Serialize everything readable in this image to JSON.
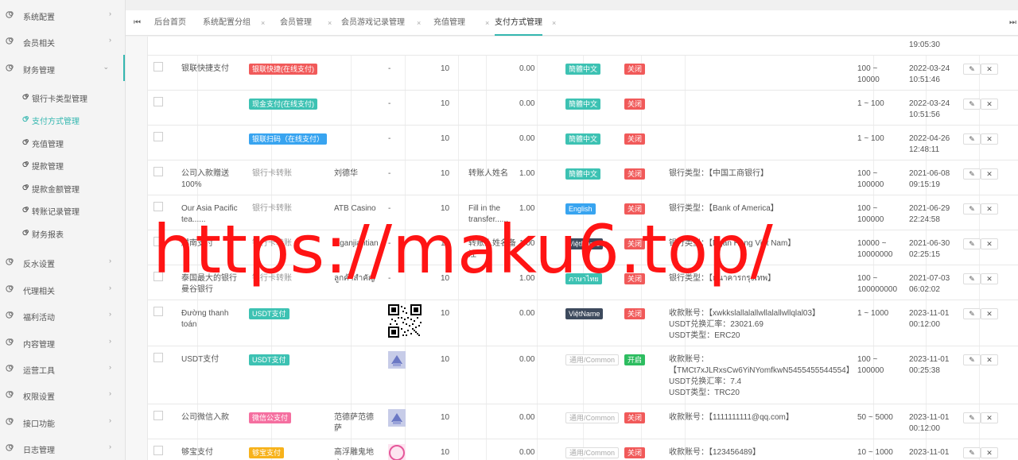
{
  "sidebar": {
    "items": [
      {
        "label": "系统配置",
        "arrow": "›"
      },
      {
        "label": "会员相关",
        "arrow": "›"
      },
      {
        "label": "财务管理",
        "arrow": "⌄"
      },
      {
        "label": "反水设置",
        "arrow": "›"
      },
      {
        "label": "代理相关",
        "arrow": "›"
      },
      {
        "label": "福利活动",
        "arrow": "›"
      },
      {
        "label": "内容管理",
        "arrow": "›"
      },
      {
        "label": "运营工具",
        "arrow": "›"
      },
      {
        "label": "权限设置",
        "arrow": "›"
      },
      {
        "label": "接口功能",
        "arrow": "›"
      },
      {
        "label": "日志管理",
        "arrow": "›"
      }
    ],
    "sub_items": [
      {
        "label": "银行卡类型管理"
      },
      {
        "label": "支付方式管理"
      },
      {
        "label": "充值管理"
      },
      {
        "label": "提款管理"
      },
      {
        "label": "提款金额管理"
      },
      {
        "label": "转账记录管理"
      },
      {
        "label": "财务报表"
      }
    ]
  },
  "tabs": {
    "first_icon": "⏮",
    "last_icon": "⏭",
    "items": [
      {
        "label": "后台首页",
        "close": ""
      },
      {
        "label": "系统配置分组",
        "close": "×"
      },
      {
        "label": "会员管理",
        "close": "×"
      },
      {
        "label": "会员游戏记录管理",
        "close": "×"
      },
      {
        "label": "充值管理",
        "close": "×"
      },
      {
        "label": "支付方式管理",
        "close": "×"
      }
    ]
  },
  "watermark": "https://maku6.top/",
  "top_partial": {
    "time": "19:05:30"
  },
  "rows": [
    {
      "name": "银联快捷支付",
      "type": "银联快捷(在线支付)",
      "type_color": "red",
      "account_name": "",
      "qr": "-",
      "sort": "10",
      "fee_label": "",
      "fee": "0.00",
      "lang": "簡體中文",
      "lang_color": "teal",
      "status": "关闭",
      "status_color": "red",
      "info": [
        "",
        ""
      ],
      "range": [
        "100 ~",
        "10000"
      ],
      "date": [
        "2022-03-24",
        "10:51:46"
      ]
    },
    {
      "name": "",
      "type": "现金支付(在线支付)",
      "type_color": "teal",
      "account_name": "",
      "qr": "-",
      "sort": "10",
      "fee_label": "",
      "fee": "0.00",
      "lang": "簡體中文",
      "lang_color": "teal",
      "status": "关闭",
      "status_color": "red",
      "info": [
        "",
        ""
      ],
      "range": [
        "1 ~ 100",
        ""
      ],
      "date": [
        "2022-03-24",
        "10:51:56"
      ]
    },
    {
      "name": "",
      "type": "银联扫码（在线支付）",
      "type_color": "blue",
      "account_name": "",
      "qr": "-",
      "sort": "10",
      "fee_label": "",
      "fee": "0.00",
      "lang": "簡體中文",
      "lang_color": "teal",
      "status": "关闭",
      "status_color": "red",
      "info": [
        "",
        ""
      ],
      "range": [
        "1 ~ 100",
        ""
      ],
      "date": [
        "2022-04-26",
        "12:48:11"
      ]
    },
    {
      "name": "公司入款赠送100%",
      "type": "银行卡转账",
      "type_color": "plain",
      "account_name": "刘德华",
      "qr": "-",
      "sort": "10",
      "fee_label": "转账人姓名",
      "fee": "1.00",
      "lang": "簡體中文",
      "lang_color": "teal",
      "status": "关闭",
      "status_color": "red",
      "info": [
        "银行类型：【中国工商银行】",
        ""
      ],
      "range": [
        "100 ~",
        "100000"
      ],
      "date": [
        "2021-06-08",
        "09:15:19"
      ]
    },
    {
      "name": "Our Asia Pacific tea......",
      "type": "银行卡转账",
      "type_color": "plain",
      "account_name": "ATB Casino",
      "qr": "-",
      "sort": "10",
      "fee_label": "Fill in the transfer......",
      "fee": "1.00",
      "lang": "English",
      "lang_color": "blue",
      "status": "关闭",
      "status_color": "red",
      "info": [
        "银行类型：【Bank of America】",
        ""
      ],
      "range": [
        "100 ~",
        "100000"
      ],
      "date": [
        "2021-06-29",
        "22:24:58"
      ]
    },
    {
      "name": "越南支付",
      "type": "银行卡转账",
      "type_color": "plain",
      "account_name": "Nganjiantian",
      "qr": "-",
      "sort": "10",
      "fee_label": "转账人姓名备注",
      "fee": "1.00",
      "lang": "ViệtName",
      "lang_color": "dark",
      "status": "关闭",
      "status_color": "red",
      "info": [
        "银行类型：【Ngân Hàng Việt Nam】",
        ""
      ],
      "range": [
        "10000 ~",
        "10000000"
      ],
      "date": [
        "2021-06-30",
        "02:25:15"
      ]
    },
    {
      "name": "泰国最大的银行曼谷银行",
      "type": "银行卡转账",
      "type_color": "plain",
      "account_name": "ลูกค้าสำคัญ",
      "qr": "-",
      "sort": "10",
      "fee_label": "",
      "fee": "1.00",
      "lang": "ภาษาไทย",
      "lang_color": "teal",
      "status": "关闭",
      "status_color": "red",
      "info": [
        "银行类型：【ธนาคารกรุงเทพ】",
        ""
      ],
      "range": [
        "100 ~",
        "100000000"
      ],
      "date": [
        "2021-07-03",
        "06:02:02"
      ]
    },
    {
      "name": "Đường thanh toán",
      "type": "USDT支付",
      "type_color": "teal",
      "account_name": "",
      "qr": "qr",
      "sort": "10",
      "fee_label": "",
      "fee": "0.00",
      "lang": "ViệtName",
      "lang_color": "dark",
      "status": "关闭",
      "status_color": "red",
      "info": [
        "收款账号：【xwkkslallalallwllalallwllqlal03】",
        "USDT兑换汇率：23021.69",
        "USDT类型：ERC20"
      ],
      "range": [
        "1 ~ 1000",
        ""
      ],
      "date": [
        "2023-11-01",
        "00:12:00"
      ]
    },
    {
      "name": "USDT支付",
      "type": "USDT支付",
      "type_color": "teal",
      "account_name": "",
      "qr": "thumb",
      "sort": "10",
      "fee_label": "",
      "fee": "0.00",
      "lang": "通用/Common",
      "lang_color": "gray",
      "status": "开启",
      "status_color": "green",
      "info": [
        "收款账号：",
        "【TMCt7xJLRxsCw6YiNYomfkwN5455455544554】",
        "USDT兑换汇率：7.4",
        "USDT类型：TRC20"
      ],
      "range": [
        "100 ~",
        "100000"
      ],
      "date": [
        "2023-11-01",
        "00:25:38"
      ]
    },
    {
      "name": "公司微信入款",
      "type": "微信公支付",
      "type_color": "pink",
      "account_name": "范德萨范德萨",
      "qr": "thumb",
      "sort": "10",
      "fee_label": "",
      "fee": "0.00",
      "lang": "通用/Common",
      "lang_color": "gray",
      "status": "关闭",
      "status_color": "red",
      "info": [
        "收款账号：【1111111111@qq.com】",
        ""
      ],
      "range": [
        "50 ~ 5000",
        ""
      ],
      "date": [
        "2023-11-01",
        "00:12:00"
      ]
    },
    {
      "name": "够宝支付",
      "type": "够宝支付",
      "type_color": "orange",
      "account_name": "高浮雕鬼地方",
      "qr": "logo",
      "sort": "10",
      "fee_label": "",
      "fee": "0.00",
      "lang": "通用/Common",
      "lang_color": "gray",
      "status": "关闭",
      "status_color": "red",
      "info": [
        "收款账号：【123456489】",
        ""
      ],
      "range": [
        "10 ~ 1000",
        ""
      ],
      "date": [
        "2023-11-01",
        ""
      ]
    }
  ],
  "actions": {
    "edit_icon": "✎",
    "delete_icon": "✕"
  }
}
